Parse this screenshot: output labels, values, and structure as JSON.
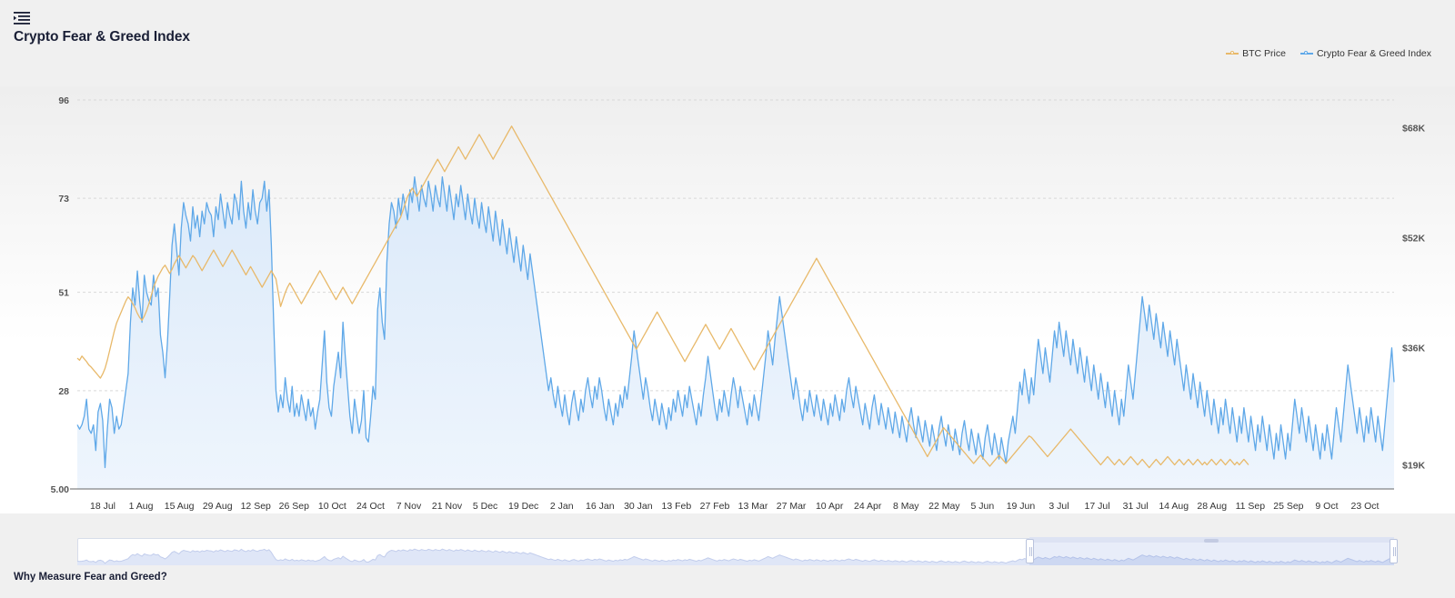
{
  "header": {
    "menu_icon": "list-indent-icon",
    "title": "Crypto Fear & Greed Index"
  },
  "legend": {
    "items": [
      {
        "label": "BTC Price",
        "color": "#e8b96a",
        "icon": "line-marker-icon"
      },
      {
        "label": "Crypto Fear & Greed Index",
        "color": "#5fa8e8",
        "icon": "line-marker-icon"
      }
    ]
  },
  "footer": {
    "heading": "Why Measure Fear and Greed?"
  },
  "navigator": {
    "name": "range-selector",
    "selection_start_pct": 72.3,
    "selection_end_pct": 100.0,
    "left_handle": "range-handle-left",
    "right_handle": "range-handle-right"
  },
  "chart_data": {
    "type": "line",
    "title": "Crypto Fear & Greed Index",
    "xlabel": "",
    "ylabel": "Crypto Fear & Greed Index",
    "y2label": "BTC Price",
    "grid": true,
    "legend_position": "top-right",
    "y_left_ticks": [
      "5.00",
      "28",
      "51",
      "73",
      "96"
    ],
    "y_left_values": [
      5,
      28,
      51,
      73,
      96
    ],
    "ylim": [
      5,
      96
    ],
    "y_right_ticks": [
      "$19K",
      "$36K",
      "$52K",
      "$68K"
    ],
    "y_right_values": [
      19000,
      36000,
      52000,
      68000
    ],
    "y2lim": [
      15500,
      72000
    ],
    "x_tick_labels": [
      "18 Jul",
      "1 Aug",
      "15 Aug",
      "29 Aug",
      "12 Sep",
      "26 Sep",
      "10 Oct",
      "24 Oct",
      "7 Nov",
      "21 Nov",
      "5 Dec",
      "19 Dec",
      "2 Jan",
      "16 Jan",
      "30 Jan",
      "13 Feb",
      "27 Feb",
      "13 Mar",
      "27 Mar",
      "10 Apr",
      "24 Apr",
      "8 May",
      "22 May",
      "5 Jun",
      "19 Jun",
      "3 Jul",
      "17 Jul",
      "31 Jul",
      "14 Aug",
      "28 Aug",
      "11 Sep",
      "25 Sep",
      "9 Oct",
      "23 Oct"
    ],
    "series": [
      {
        "name": "Crypto Fear & Greed Index",
        "color": "#5fa8e8",
        "fill": "#e9f3fc",
        "axis": "left",
        "values": [
          20,
          19,
          20,
          22,
          26,
          19,
          18,
          20,
          14,
          23,
          25,
          21,
          10,
          19,
          26,
          24,
          18,
          22,
          19,
          20,
          24,
          28,
          32,
          44,
          52,
          48,
          56,
          49,
          44,
          55,
          51,
          49,
          48,
          55,
          50,
          52,
          41,
          37,
          31,
          39,
          50,
          62,
          67,
          61,
          55,
          66,
          72,
          69,
          67,
          63,
          71,
          66,
          69,
          64,
          70,
          67,
          72,
          70,
          69,
          64,
          71,
          68,
          74,
          70,
          66,
          72,
          69,
          67,
          74,
          72,
          68,
          77,
          70,
          66,
          72,
          68,
          75,
          70,
          67,
          72,
          73,
          77,
          70,
          75,
          62,
          44,
          28,
          23,
          27,
          24,
          31,
          26,
          23,
          29,
          22,
          25,
          22,
          27,
          24,
          21,
          26,
          22,
          24,
          19,
          23,
          26,
          34,
          42,
          30,
          24,
          22,
          29,
          33,
          37,
          31,
          44,
          36,
          29,
          22,
          18,
          26,
          22,
          18,
          21,
          28,
          17,
          16,
          22,
          29,
          26,
          47,
          52,
          44,
          40,
          58,
          67,
          72,
          70,
          66,
          73,
          69,
          74,
          71,
          68,
          75,
          72,
          78,
          74,
          70,
          76,
          73,
          71,
          77,
          74,
          70,
          76,
          73,
          71,
          78,
          74,
          70,
          76,
          72,
          68,
          74,
          71,
          76,
          72,
          68,
          74,
          70,
          67,
          73,
          69,
          66,
          72,
          68,
          65,
          71,
          67,
          63,
          70,
          66,
          62,
          68,
          64,
          60,
          66,
          62,
          58,
          64,
          60,
          56,
          62,
          58,
          54,
          60,
          56,
          52,
          48,
          44,
          40,
          36,
          32,
          28,
          31,
          27,
          24,
          29,
          25,
          22,
          27,
          23,
          20,
          25,
          28,
          24,
          21,
          26,
          23,
          28,
          31,
          27,
          24,
          29,
          26,
          31,
          28,
          24,
          21,
          26,
          23,
          20,
          25,
          22,
          27,
          24,
          29,
          26,
          31,
          36,
          42,
          38,
          34,
          30,
          26,
          31,
          28,
          24,
          21,
          26,
          23,
          20,
          25,
          22,
          19,
          24,
          21,
          26,
          23,
          28,
          25,
          22,
          27,
          24,
          29,
          26,
          23,
          20,
          25,
          22,
          27,
          31,
          36,
          32,
          28,
          24,
          21,
          26,
          23,
          28,
          25,
          22,
          27,
          31,
          28,
          24,
          29,
          26,
          23,
          20,
          25,
          22,
          27,
          24,
          21,
          26,
          31,
          36,
          42,
          38,
          34,
          40,
          45,
          50,
          46,
          42,
          38,
          34,
          30,
          26,
          31,
          28,
          24,
          21,
          26,
          23,
          28,
          25,
          22,
          27,
          24,
          21,
          26,
          23,
          20,
          25,
          22,
          27,
          24,
          21,
          26,
          23,
          28,
          31,
          27,
          24,
          29,
          26,
          23,
          20,
          25,
          22,
          19,
          24,
          27,
          23,
          20,
          25,
          22,
          19,
          24,
          21,
          18,
          23,
          20,
          17,
          22,
          19,
          16,
          21,
          24,
          20,
          17,
          22,
          19,
          16,
          21,
          18,
          15,
          20,
          17,
          14,
          19,
          22,
          18,
          15,
          20,
          17,
          14,
          19,
          16,
          13,
          18,
          21,
          17,
          14,
          19,
          16,
          13,
          18,
          15,
          12,
          17,
          20,
          16,
          13,
          18,
          15,
          12,
          17,
          14,
          11,
          16,
          19,
          22,
          18,
          24,
          30,
          27,
          33,
          29,
          25,
          31,
          27,
          34,
          40,
          36,
          32,
          38,
          34,
          30,
          36,
          42,
          38,
          44,
          40,
          36,
          42,
          38,
          34,
          40,
          36,
          32,
          38,
          34,
          30,
          36,
          32,
          28,
          34,
          30,
          26,
          32,
          28,
          24,
          30,
          26,
          22,
          28,
          24,
          20,
          26,
          22,
          28,
          34,
          30,
          26,
          32,
          38,
          44,
          50,
          46,
          42,
          48,
          44,
          40,
          46,
          42,
          38,
          44,
          40,
          36,
          42,
          38,
          34,
          40,
          36,
          32,
          28,
          34,
          30,
          26,
          32,
          28,
          24,
          30,
          26,
          22,
          28,
          24,
          20,
          26,
          22,
          18,
          24,
          20,
          26,
          22,
          18,
          24,
          20,
          16,
          22,
          18,
          24,
          20,
          16,
          22,
          18,
          14,
          20,
          16,
          22,
          18,
          14,
          20,
          16,
          12,
          18,
          14,
          20,
          16,
          12,
          18,
          14,
          20,
          26,
          22,
          18,
          24,
          20,
          16,
          22,
          18,
          14,
          20,
          16,
          12,
          18,
          14,
          20,
          16,
          12,
          18,
          24,
          20,
          16,
          22,
          28,
          34,
          30,
          26,
          22,
          18,
          24,
          20,
          16,
          22,
          18,
          24,
          20,
          16,
          22,
          18,
          14,
          20,
          26,
          32,
          38,
          30
        ]
      },
      {
        "name": "BTC Price",
        "color": "#e8b96a",
        "axis": "right",
        "values_k": [
          34.5,
          34.2,
          34.8,
          34.4,
          34.0,
          33.5,
          33.2,
          32.8,
          32.4,
          32.0,
          31.6,
          32.2,
          33.0,
          34.2,
          35.6,
          37.0,
          38.4,
          39.6,
          40.4,
          41.2,
          42.0,
          42.8,
          43.4,
          43.0,
          42.4,
          41.8,
          41.0,
          40.4,
          40.0,
          40.6,
          41.4,
          42.4,
          43.6,
          44.8,
          45.6,
          46.4,
          47.0,
          47.6,
          48.0,
          47.4,
          46.8,
          47.4,
          48.2,
          48.8,
          49.4,
          48.8,
          48.2,
          47.6,
          48.2,
          48.8,
          49.4,
          49.0,
          48.4,
          47.8,
          47.2,
          47.8,
          48.4,
          49.0,
          49.6,
          50.2,
          49.6,
          49.0,
          48.4,
          47.8,
          48.4,
          49.0,
          49.6,
          50.2,
          49.6,
          49.0,
          48.4,
          47.8,
          47.2,
          46.6,
          47.2,
          47.8,
          47.2,
          46.6,
          46.0,
          45.4,
          44.8,
          45.4,
          46.0,
          46.6,
          47.2,
          46.6,
          46.0,
          44.0,
          42.0,
          43.0,
          44.0,
          44.8,
          45.4,
          44.8,
          44.2,
          43.6,
          43.0,
          42.4,
          43.0,
          43.6,
          44.2,
          44.8,
          45.4,
          46.0,
          46.6,
          47.2,
          46.6,
          46.0,
          45.4,
          44.8,
          44.2,
          43.6,
          43.0,
          43.6,
          44.2,
          44.8,
          44.2,
          43.6,
          43.0,
          42.4,
          43.0,
          43.6,
          44.2,
          44.8,
          45.4,
          46.0,
          46.6,
          47.2,
          47.8,
          48.4,
          49.0,
          49.6,
          50.2,
          50.8,
          51.4,
          52.0,
          52.6,
          53.2,
          53.8,
          54.4,
          55.0,
          56.0,
          57.0,
          58.0,
          58.6,
          59.2,
          58.6,
          58.0,
          58.6,
          59.2,
          59.8,
          60.4,
          61.0,
          61.6,
          62.2,
          62.8,
          63.4,
          62.8,
          62.2,
          61.6,
          62.2,
          62.8,
          63.4,
          64.0,
          64.6,
          65.2,
          64.6,
          64.0,
          63.4,
          64.0,
          64.6,
          65.2,
          65.8,
          66.4,
          67.0,
          66.4,
          65.8,
          65.2,
          64.6,
          64.0,
          63.4,
          64.0,
          64.6,
          65.2,
          65.8,
          66.4,
          67.0,
          67.6,
          68.2,
          67.6,
          67.0,
          66.4,
          65.8,
          65.2,
          64.6,
          64.0,
          63.4,
          62.8,
          62.2,
          61.6,
          61.0,
          60.4,
          59.8,
          59.2,
          58.6,
          58.0,
          57.4,
          56.8,
          56.2,
          55.6,
          55.0,
          54.4,
          53.8,
          53.2,
          52.6,
          52.0,
          51.4,
          50.8,
          50.2,
          49.6,
          49.0,
          48.4,
          47.8,
          47.2,
          46.6,
          46.0,
          45.4,
          44.8,
          44.2,
          43.6,
          43.0,
          42.4,
          41.8,
          41.2,
          40.6,
          40.0,
          39.4,
          38.8,
          38.2,
          37.6,
          37.0,
          36.4,
          35.8,
          36.4,
          37.0,
          37.6,
          38.2,
          38.8,
          39.4,
          40.0,
          40.6,
          41.2,
          40.6,
          40.0,
          39.4,
          38.8,
          38.2,
          37.6,
          37.0,
          36.4,
          35.8,
          35.2,
          34.6,
          34.0,
          34.6,
          35.2,
          35.8,
          36.4,
          37.0,
          37.6,
          38.2,
          38.8,
          39.4,
          38.8,
          38.2,
          37.6,
          37.0,
          36.4,
          35.8,
          36.4,
          37.0,
          37.6,
          38.2,
          38.8,
          38.2,
          37.6,
          37.0,
          36.4,
          35.8,
          35.2,
          34.6,
          34.0,
          33.4,
          32.8,
          33.4,
          34.0,
          34.6,
          35.2,
          35.8,
          36.4,
          37.0,
          37.6,
          38.2,
          38.8,
          39.4,
          40.0,
          40.6,
          41.2,
          41.8,
          42.4,
          43.0,
          43.6,
          44.2,
          44.8,
          45.4,
          46.0,
          46.6,
          47.2,
          47.8,
          48.4,
          49.0,
          48.4,
          47.8,
          47.2,
          46.6,
          46.0,
          45.4,
          44.8,
          44.2,
          43.6,
          43.0,
          42.4,
          41.8,
          41.2,
          40.6,
          40.0,
          39.4,
          38.8,
          38.2,
          37.6,
          37.0,
          36.4,
          35.8,
          35.2,
          34.6,
          34.0,
          33.4,
          32.8,
          32.2,
          31.6,
          31.0,
          30.4,
          29.8,
          29.2,
          28.6,
          28.0,
          27.4,
          26.8,
          26.2,
          25.6,
          25.0,
          24.4,
          23.8,
          23.2,
          22.6,
          22.0,
          21.4,
          20.8,
          20.2,
          20.8,
          21.4,
          22.0,
          22.6,
          23.2,
          23.8,
          24.4,
          24.0,
          23.6,
          23.2,
          22.8,
          22.4,
          22.0,
          21.6,
          21.2,
          20.8,
          20.4,
          20.0,
          19.6,
          19.2,
          19.6,
          20.0,
          20.4,
          20.0,
          19.6,
          19.2,
          18.8,
          19.2,
          19.6,
          20.0,
          20.4,
          20.0,
          19.6,
          19.2,
          19.6,
          20.0,
          20.4,
          20.8,
          21.2,
          21.6,
          22.0,
          22.4,
          22.8,
          23.2,
          23.0,
          22.6,
          22.2,
          21.8,
          21.4,
          21.0,
          20.6,
          20.2,
          20.6,
          21.0,
          21.4,
          21.8,
          22.2,
          22.6,
          23.0,
          23.4,
          23.8,
          24.2,
          23.8,
          23.4,
          23.0,
          22.6,
          22.2,
          21.8,
          21.4,
          21.0,
          20.6,
          20.2,
          19.8,
          19.4,
          19.0,
          19.4,
          19.8,
          20.2,
          19.8,
          19.4,
          19.0,
          19.4,
          19.8,
          19.4,
          19.0,
          19.4,
          19.8,
          20.2,
          19.8,
          19.4,
          19.0,
          19.4,
          19.8,
          19.4,
          19.0,
          18.6,
          19.0,
          19.4,
          19.8,
          19.4,
          19.0,
          19.4,
          19.8,
          20.2,
          19.8,
          19.4,
          19.0,
          19.4,
          19.8,
          19.4,
          19.0,
          19.4,
          19.8,
          19.4,
          19.0,
          19.4,
          19.8,
          19.4,
          19.0,
          19.4,
          19.0,
          19.4,
          19.8,
          19.4,
          19.0,
          19.4,
          19.8,
          19.4,
          19.0,
          19.4,
          19.8,
          19.4,
          19.0,
          19.4,
          19.0,
          19.4,
          19.8,
          19.4,
          19.0
        ]
      }
    ]
  }
}
